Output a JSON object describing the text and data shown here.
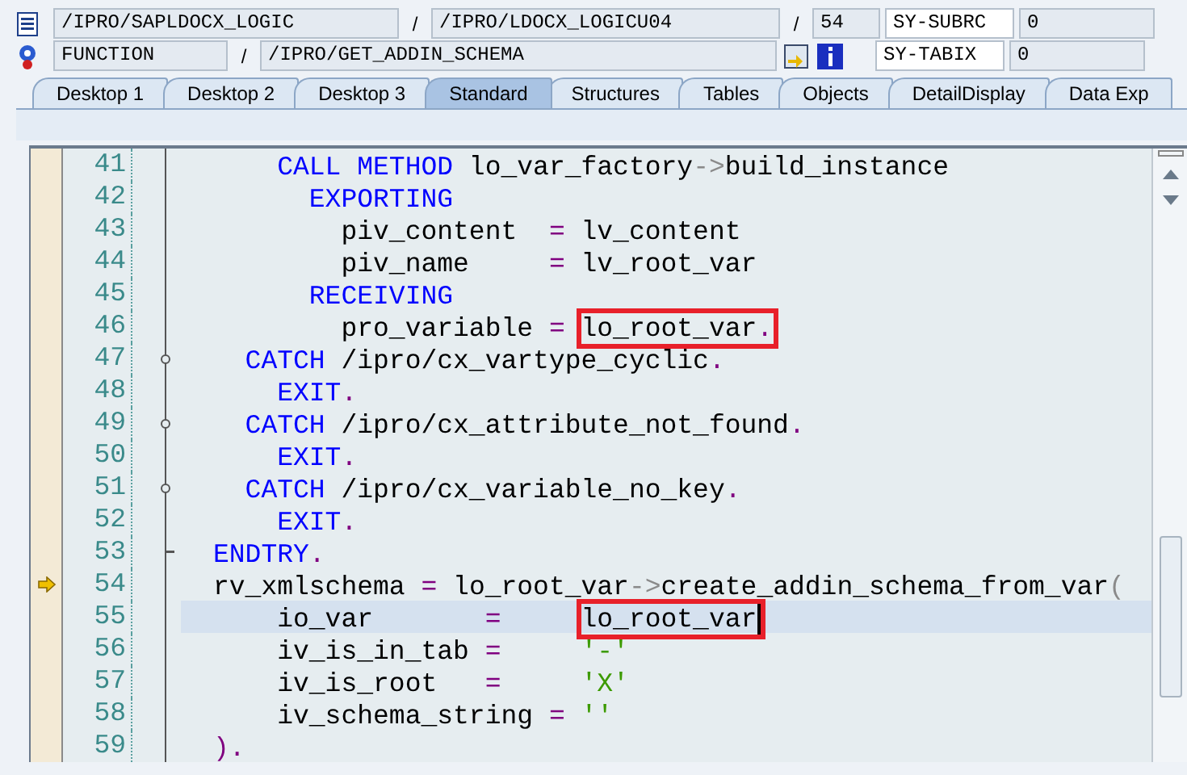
{
  "header": {
    "program": "/IPRO/SAPLDOCX_LOGIC",
    "separator_1": "/",
    "include": "/IPRO/LDOCX_LOGICU04",
    "separator_2": "/",
    "line": "54",
    "variable_1": "SY-SUBRC",
    "value_1": "0",
    "type": "FUNCTION",
    "separator_3": "/",
    "name": "/IPRO/GET_ADDIN_SCHEMA",
    "variable_2": "SY-TABIX",
    "value_2": "0"
  },
  "tabs": [
    {
      "label": "Desktop 1",
      "selected": false
    },
    {
      "label": "Desktop 2",
      "selected": false
    },
    {
      "label": "Desktop 3",
      "selected": false
    },
    {
      "label": "Standard",
      "selected": true
    },
    {
      "label": "Structures",
      "selected": false
    },
    {
      "label": "Tables",
      "selected": false
    },
    {
      "label": "Objects",
      "selected": false
    },
    {
      "label": "DetailDisplay",
      "selected": false
    },
    {
      "label": "Data Exp",
      "selected": false
    }
  ],
  "editor": {
    "lines": [
      {
        "number": "41",
        "kind": "plain",
        "current": false,
        "selected": false,
        "tokens": [
          {
            "kind": "kw",
            "text": "    CALL METHOD"
          },
          {
            "kind": "id",
            "text": " lo_var_factory"
          },
          {
            "kind": "arrow",
            "text": "->"
          },
          {
            "kind": "id",
            "text": "build_instance"
          }
        ]
      },
      {
        "number": "42",
        "kind": "plain",
        "current": false,
        "selected": false,
        "tokens": [
          {
            "kind": "kw",
            "text": "      EXPORTING"
          }
        ]
      },
      {
        "number": "43",
        "kind": "plain",
        "current": false,
        "selected": false,
        "tokens": [
          {
            "kind": "id",
            "text": "        piv_content  "
          },
          {
            "kind": "op",
            "text": "="
          },
          {
            "kind": "id",
            "text": " lv_content"
          }
        ]
      },
      {
        "number": "44",
        "kind": "plain",
        "current": false,
        "selected": false,
        "tokens": [
          {
            "kind": "id",
            "text": "        piv_name     "
          },
          {
            "kind": "op",
            "text": "="
          },
          {
            "kind": "id",
            "text": " lv_root_var"
          }
        ]
      },
      {
        "number": "45",
        "kind": "plain",
        "current": false,
        "selected": false,
        "tokens": [
          {
            "kind": "kw",
            "text": "      RECEIVING"
          }
        ]
      },
      {
        "number": "46",
        "kind": "plain",
        "current": false,
        "selected": false,
        "tokens": [
          {
            "kind": "id",
            "text": "        pro_variable "
          },
          {
            "kind": "op",
            "text": "= "
          },
          {
            "kind": "id",
            "text": "lo_root_var",
            "boxed": true
          },
          {
            "kind": "op",
            "text": ".",
            "boxed": true
          }
        ]
      },
      {
        "number": "47",
        "kind": "branch",
        "current": false,
        "selected": false,
        "tokens": [
          {
            "kind": "kw",
            "text": "  CATCH"
          },
          {
            "kind": "id",
            "text": " /ipro/cx_vartype_cyclic"
          },
          {
            "kind": "op",
            "text": "."
          }
        ]
      },
      {
        "number": "48",
        "kind": "plain",
        "current": false,
        "selected": false,
        "tokens": [
          {
            "kind": "kw",
            "text": "    EXIT"
          },
          {
            "kind": "op",
            "text": "."
          }
        ]
      },
      {
        "number": "49",
        "kind": "branch",
        "current": false,
        "selected": false,
        "tokens": [
          {
            "kind": "kw",
            "text": "  CATCH"
          },
          {
            "kind": "id",
            "text": " /ipro/cx_attribute_not_found"
          },
          {
            "kind": "op",
            "text": "."
          }
        ]
      },
      {
        "number": "50",
        "kind": "plain",
        "current": false,
        "selected": false,
        "tokens": [
          {
            "kind": "kw",
            "text": "    EXIT"
          },
          {
            "kind": "op",
            "text": "."
          }
        ]
      },
      {
        "number": "51",
        "kind": "branch",
        "current": false,
        "selected": false,
        "tokens": [
          {
            "kind": "kw",
            "text": "  CATCH"
          },
          {
            "kind": "id",
            "text": " /ipro/cx_variable_no_key"
          },
          {
            "kind": "op",
            "text": "."
          }
        ]
      },
      {
        "number": "52",
        "kind": "plain",
        "current": false,
        "selected": false,
        "tokens": [
          {
            "kind": "kw",
            "text": "    EXIT"
          },
          {
            "kind": "op",
            "text": "."
          }
        ]
      },
      {
        "number": "53",
        "kind": "end",
        "current": false,
        "selected": false,
        "tokens": [
          {
            "kind": "kw",
            "text": "ENDTRY"
          },
          {
            "kind": "op",
            "text": "."
          }
        ]
      },
      {
        "number": "54",
        "kind": "plain",
        "current": true,
        "selected": false,
        "tokens": [
          {
            "kind": "id",
            "text": "rv_xmlschema "
          },
          {
            "kind": "op",
            "text": "="
          },
          {
            "kind": "id",
            "text": " lo_root_var"
          },
          {
            "kind": "arrow",
            "text": "->"
          },
          {
            "kind": "id",
            "text": "create_addin_schema_from_var"
          },
          {
            "kind": "arrow",
            "text": "("
          }
        ]
      },
      {
        "number": "55",
        "kind": "plain",
        "current": false,
        "selected": true,
        "tokens": [
          {
            "kind": "id",
            "text": "    io_var       "
          },
          {
            "kind": "op",
            "text": "=     "
          },
          {
            "kind": "id",
            "text": "lo_root_var",
            "boxed": true,
            "cursor": true
          }
        ]
      },
      {
        "number": "56",
        "kind": "plain",
        "current": false,
        "selected": false,
        "tokens": [
          {
            "kind": "id",
            "text": "    iv_is_in_tab "
          },
          {
            "kind": "op",
            "text": "=     "
          },
          {
            "kind": "str",
            "text": "'-'"
          }
        ]
      },
      {
        "number": "57",
        "kind": "plain",
        "current": false,
        "selected": false,
        "tokens": [
          {
            "kind": "id",
            "text": "    iv_is_root   "
          },
          {
            "kind": "op",
            "text": "=     "
          },
          {
            "kind": "str",
            "text": "'X'"
          }
        ]
      },
      {
        "number": "58",
        "kind": "plain",
        "current": false,
        "selected": false,
        "tokens": [
          {
            "kind": "id",
            "text": "    iv_schema_string "
          },
          {
            "kind": "op",
            "text": "= "
          },
          {
            "kind": "str",
            "text": "''"
          }
        ]
      },
      {
        "number": "59",
        "kind": "plain",
        "current": false,
        "selected": false,
        "tokens": [
          {
            "kind": "op",
            "text": ")."
          }
        ]
      }
    ]
  }
}
